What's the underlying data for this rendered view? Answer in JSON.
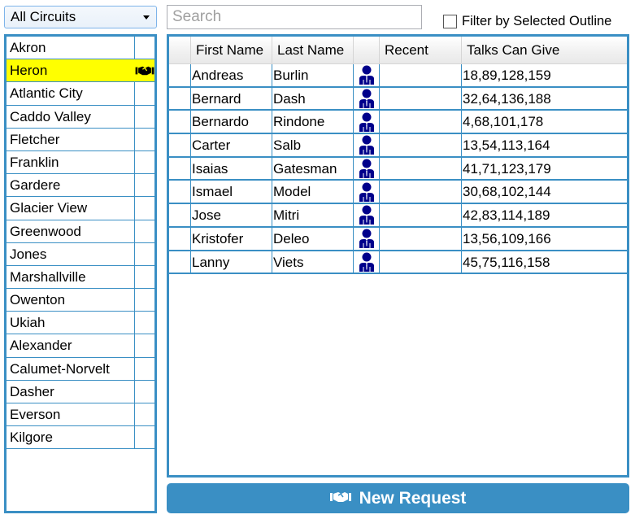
{
  "circuit_filter": {
    "selected": "All Circuits",
    "icon": "dropdown-arrow-icon"
  },
  "search": {
    "placeholder": "Search",
    "value": ""
  },
  "filter_checkbox": {
    "label": "Filter by Selected Outline",
    "checked": false
  },
  "circuits": [
    {
      "name": "Akron",
      "selected": false,
      "icon": null
    },
    {
      "name": "Heron",
      "selected": true,
      "icon": "handshake-icon"
    },
    {
      "name": "Atlantic City",
      "selected": false,
      "icon": null
    },
    {
      "name": "Caddo Valley",
      "selected": false,
      "icon": null
    },
    {
      "name": "Fletcher",
      "selected": false,
      "icon": null
    },
    {
      "name": "Franklin",
      "selected": false,
      "icon": null
    },
    {
      "name": "Gardere",
      "selected": false,
      "icon": null
    },
    {
      "name": "Glacier View",
      "selected": false,
      "icon": null
    },
    {
      "name": "Greenwood",
      "selected": false,
      "icon": null
    },
    {
      "name": "Jones",
      "selected": false,
      "icon": null
    },
    {
      "name": "Marshallville",
      "selected": false,
      "icon": null
    },
    {
      "name": "Owenton",
      "selected": false,
      "icon": null
    },
    {
      "name": "Ukiah",
      "selected": false,
      "icon": null
    },
    {
      "name": "Alexander",
      "selected": false,
      "icon": null
    },
    {
      "name": "Calumet-Norvelt",
      "selected": false,
      "icon": null
    },
    {
      "name": "Dasher",
      "selected": false,
      "icon": null
    },
    {
      "name": "Everson",
      "selected": false,
      "icon": null
    },
    {
      "name": "Kilgore",
      "selected": false,
      "icon": null
    }
  ],
  "grid": {
    "columns": [
      "",
      "First Name",
      "Last Name",
      "",
      "Recent",
      "Talks Can Give"
    ],
    "rows": [
      {
        "first": "Andreas",
        "last": "Burlin",
        "icon": "person-suit-icon",
        "recent": "",
        "talks": "18,89,128,159"
      },
      {
        "first": "Bernard",
        "last": "Dash",
        "icon": "person-suit-icon",
        "recent": "",
        "talks": "32,64,136,188"
      },
      {
        "first": "Bernardo",
        "last": "Rindone",
        "icon": "person-suit-icon",
        "recent": "",
        "talks": "4,68,101,178"
      },
      {
        "first": "Carter",
        "last": "Salb",
        "icon": "person-suit-icon",
        "recent": "",
        "talks": "13,54,113,164"
      },
      {
        "first": "Isaias",
        "last": "Gatesman",
        "icon": "person-suit-icon",
        "recent": "",
        "talks": "41,71,123,179"
      },
      {
        "first": "Ismael",
        "last": "Model",
        "icon": "person-suit-icon",
        "recent": "",
        "talks": "30,68,102,144"
      },
      {
        "first": "Jose",
        "last": "Mitri",
        "icon": "person-suit-icon",
        "recent": "",
        "talks": "42,83,114,189"
      },
      {
        "first": "Kristofer",
        "last": "Deleo",
        "icon": "person-suit-icon",
        "recent": "",
        "talks": "13,56,109,166"
      },
      {
        "first": "Lanny",
        "last": "Viets",
        "icon": "person-suit-icon",
        "recent": "",
        "talks": "45,75,116,158"
      }
    ]
  },
  "new_request_button": {
    "label": "New Request",
    "icon": "handshake-icon"
  },
  "colors": {
    "accent": "#3a8fc4",
    "selected_row": "#ffff00",
    "person_icon": "#00008b"
  }
}
